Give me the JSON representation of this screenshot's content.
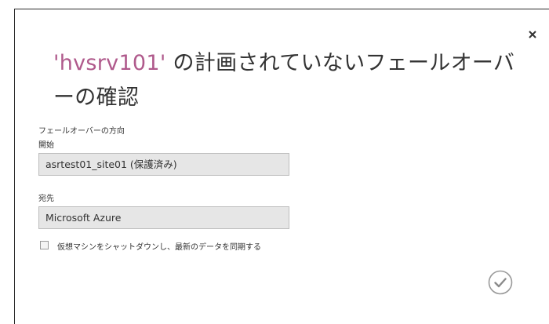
{
  "dialog": {
    "title_name": "'hvsrv101'",
    "title_rest": " の計画されていないフェールオーバーの確認",
    "section_label": "フェールオーバーの方向",
    "from_label": "開始",
    "from_value": "asrtest01_site01 (保護済み)",
    "to_label": "宛先",
    "to_value": "Microsoft Azure",
    "checkbox_label": "仮想マシンをシャットダウンし、最新のデータを同期する",
    "checkbox_checked": false
  },
  "icons": {
    "close": "close-icon",
    "confirm": "checkmark-circle-icon"
  },
  "colors": {
    "title_accent": "#b05a8c",
    "text": "#333333",
    "field_bg": "#e6e6e6"
  }
}
